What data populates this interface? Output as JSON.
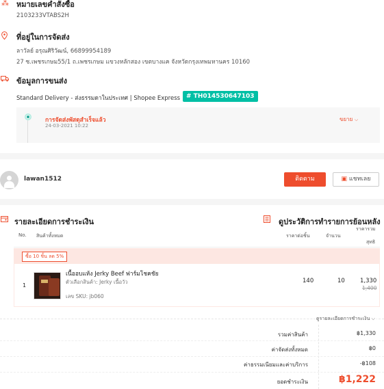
{
  "order": {
    "title": "หมายเลขคำสั่งซื้อ",
    "number": "2103233VTABS2H"
  },
  "address": {
    "title": "ที่อยู่ในการจัดส่ง",
    "name_phone": "ลาวัลย์ อรุณศิริวัฒน์, 66899954189",
    "line": "27 ซ.เพชรเกษม55/1 ถ.เพชรเกษม แขวงหลักสอง เขตบางแค จังหวัดกรุงเทพมหานคร 10160"
  },
  "shipping": {
    "title": "ข้อมูลการขนส่ง",
    "method": "Standard Delivery - ส่งธรรมดาในประเทศ | Shopee Express",
    "tracking": "# TH014530647103",
    "status": "การจัดส่งพัสดุสำเร็จแล้ว",
    "status_time": "24-03-2021 10:22",
    "expand_label": "ขยาย"
  },
  "seller": {
    "username": "lawan1512",
    "follow_label": "ติดตาม",
    "chat_label": "แชทเลย"
  },
  "payment": {
    "title": "รายละเอียดการชำระเงิน",
    "history_label": "ดูประวัติการทำรายการย้อนหลัง",
    "headers": {
      "no": "No.",
      "product": "สินค้าทั้งหมด",
      "unit_price": "ราคาต่อชิ้น",
      "qty": "จำนวน",
      "net_line1": "ราคารวม",
      "net_line2": "สุทธิ"
    },
    "promo": "ซื้อ 10 ชิ้น ลด 5%",
    "items": [
      {
        "no": "1",
        "name": "เนื้ออบแห้ง Jerky Beef ฟาร์มโชคชัย",
        "variant": "ตัวเลือกสินค้า: Jerky เนื้อวัว",
        "sku": "เลข SKU:  jb060",
        "unit_price": "140",
        "qty": "10",
        "net": "1,330",
        "original": "1,400"
      }
    ],
    "breakdown_link": "ดูรายละเอียดการชำระเงิน",
    "summary": [
      {
        "label": "รวมค่าสินค้า",
        "value": "฿1,330"
      },
      {
        "label": "ค่าจัดส่งทั้งหมด",
        "value": "฿0"
      },
      {
        "label": "ค่าธรรมเนียมและค่าบริการ",
        "value": "-฿108"
      }
    ],
    "total_label": "ยอดชำระเงิน",
    "total_value": "฿1,222"
  },
  "colors": {
    "accent": "#ee4d2d",
    "tracking": "#00bfa5"
  }
}
